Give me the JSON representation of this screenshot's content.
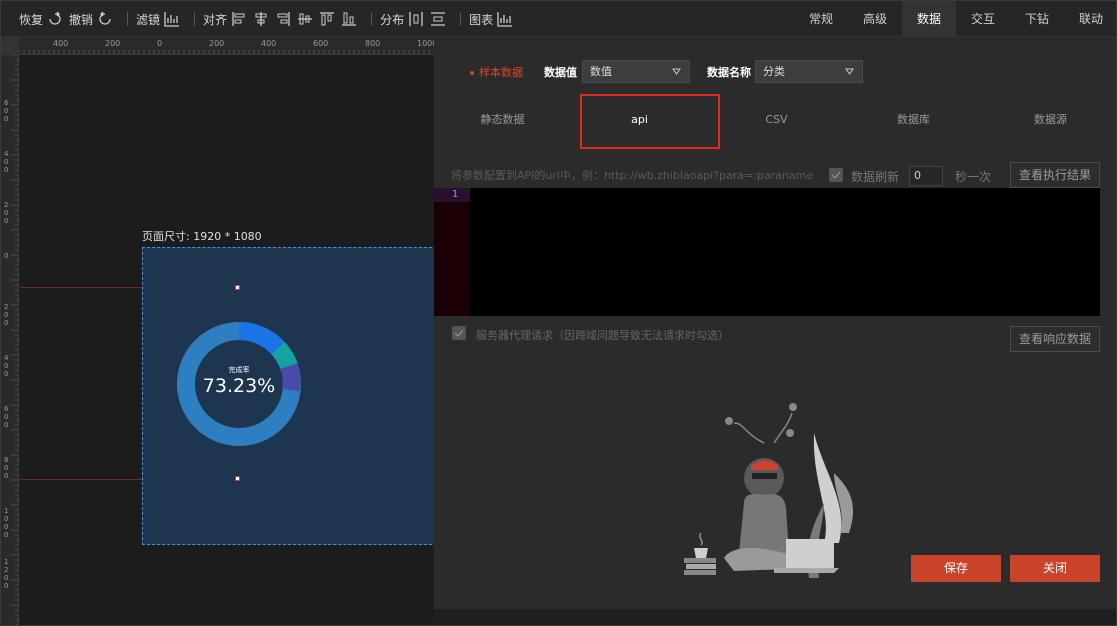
{
  "toolbar": {
    "undo_label": "恢复",
    "redo_label": "撤销",
    "filter_label": "滤镜",
    "align_label": "对齐",
    "distribute_label": "分布",
    "chart_label": "图表"
  },
  "top_tabs": [
    {
      "label": "常规"
    },
    {
      "label": "高级"
    },
    {
      "label": "数据"
    },
    {
      "label": "交互"
    },
    {
      "label": "下钻"
    },
    {
      "label": "联动"
    }
  ],
  "ruler": {
    "h_ticks": [
      "400",
      "200",
      "0",
      "200",
      "400",
      "600",
      "800",
      "1000"
    ],
    "v_ticks": [
      "600",
      "400",
      "200",
      "0",
      "200",
      "400",
      "600",
      "800",
      "1000",
      "1200"
    ]
  },
  "canvas": {
    "page_size_label": "页面尺寸: 1920 * 1080",
    "donut": {
      "small_label": "完成率",
      "value_label": "73.23%",
      "segment_colors": [
        "#1b73e8",
        "#14a3a3",
        "#4a4aa8",
        "#2e7fc2"
      ]
    }
  },
  "panel": {
    "sample_label": "样本数据",
    "value_field_label": "数据值",
    "value_field_select": "数值",
    "name_field_label": "数据名称",
    "name_field_select": "分类",
    "data_tabs": [
      {
        "label": "静态数据"
      },
      {
        "label": "api"
      },
      {
        "label": "CSV"
      },
      {
        "label": "数据库"
      },
      {
        "label": "数据源"
      }
    ],
    "hint": "将参数配置到API的url中，例：http://wb.zhibiaoapi?para=:paraname",
    "refresh_label": "数据刷新",
    "refresh_value": "0",
    "per_unit_label": "秒一次",
    "view_result_button": "查看执行结果",
    "editor_line_number": "1",
    "proxy_label": "服务器代理请求（因跨域问题导致无法请求时勾选）",
    "view_response_button": "查看响应数据",
    "save_button": "保存",
    "close_button": "关闭"
  },
  "colors": {
    "accent_red": "#c8432a",
    "highlight_red": "#e0281c",
    "page_bg": "#1e3550"
  }
}
